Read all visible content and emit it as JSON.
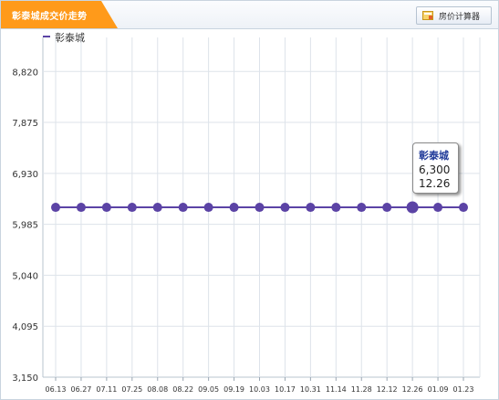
{
  "header": {
    "title": "彰泰城成交价走势",
    "calc_button_label": "房价计算器"
  },
  "legend": {
    "label": "彰泰城"
  },
  "tooltip": {
    "name": "彰泰城",
    "value": "6,300",
    "date": "12.26"
  },
  "colors": {
    "series": "#5b43a5",
    "title_tab": "#ff9a1a",
    "grid": "#dde3ea",
    "tooltip_name": "#1f3a99"
  },
  "chart_data": {
    "type": "line",
    "title": "彰泰城成交价走势",
    "xlabel": "",
    "ylabel": "",
    "categories": [
      "06.13",
      "06.27",
      "07.11",
      "07.25",
      "08.08",
      "08.22",
      "09.05",
      "09.19",
      "10.03",
      "10.17",
      "10.31",
      "11.14",
      "11.28",
      "12.12",
      "12.26",
      "01.09",
      "01.23"
    ],
    "series": [
      {
        "name": "彰泰城",
        "values": [
          6300,
          6300,
          6300,
          6300,
          6300,
          6300,
          6300,
          6300,
          6300,
          6300,
          6300,
          6300,
          6300,
          6300,
          6300,
          6300,
          6300
        ]
      }
    ],
    "ylim": [
      3150,
      9451
    ],
    "yticks": [
      3150,
      4095,
      5040,
      5985,
      6930,
      7875,
      8820
    ],
    "ytick_labels": [
      "3,150",
      "4,095",
      "5,040",
      "5,985",
      "6,930",
      "7,875",
      "8,820"
    ],
    "highlight_category": "12.26",
    "grid": true,
    "legend_position": "top-left"
  }
}
